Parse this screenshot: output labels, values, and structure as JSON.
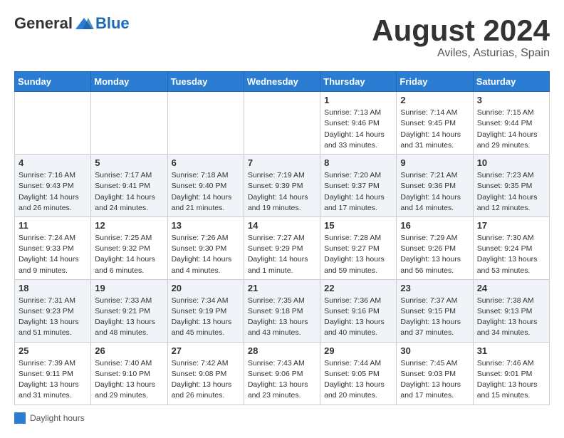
{
  "header": {
    "logo": {
      "general": "General",
      "blue": "Blue"
    },
    "title": "August 2024",
    "location": "Aviles, Asturias, Spain"
  },
  "calendar": {
    "days_of_week": [
      "Sunday",
      "Monday",
      "Tuesday",
      "Wednesday",
      "Thursday",
      "Friday",
      "Saturday"
    ],
    "weeks": [
      [
        {
          "day": "",
          "info": ""
        },
        {
          "day": "",
          "info": ""
        },
        {
          "day": "",
          "info": ""
        },
        {
          "day": "",
          "info": ""
        },
        {
          "day": "1",
          "info": "Sunrise: 7:13 AM\nSunset: 9:46 PM\nDaylight: 14 hours and 33 minutes."
        },
        {
          "day": "2",
          "info": "Sunrise: 7:14 AM\nSunset: 9:45 PM\nDaylight: 14 hours and 31 minutes."
        },
        {
          "day": "3",
          "info": "Sunrise: 7:15 AM\nSunset: 9:44 PM\nDaylight: 14 hours and 29 minutes."
        }
      ],
      [
        {
          "day": "4",
          "info": "Sunrise: 7:16 AM\nSunset: 9:43 PM\nDaylight: 14 hours and 26 minutes."
        },
        {
          "day": "5",
          "info": "Sunrise: 7:17 AM\nSunset: 9:41 PM\nDaylight: 14 hours and 24 minutes."
        },
        {
          "day": "6",
          "info": "Sunrise: 7:18 AM\nSunset: 9:40 PM\nDaylight: 14 hours and 21 minutes."
        },
        {
          "day": "7",
          "info": "Sunrise: 7:19 AM\nSunset: 9:39 PM\nDaylight: 14 hours and 19 minutes."
        },
        {
          "day": "8",
          "info": "Sunrise: 7:20 AM\nSunset: 9:37 PM\nDaylight: 14 hours and 17 minutes."
        },
        {
          "day": "9",
          "info": "Sunrise: 7:21 AM\nSunset: 9:36 PM\nDaylight: 14 hours and 14 minutes."
        },
        {
          "day": "10",
          "info": "Sunrise: 7:23 AM\nSunset: 9:35 PM\nDaylight: 14 hours and 12 minutes."
        }
      ],
      [
        {
          "day": "11",
          "info": "Sunrise: 7:24 AM\nSunset: 9:33 PM\nDaylight: 14 hours and 9 minutes."
        },
        {
          "day": "12",
          "info": "Sunrise: 7:25 AM\nSunset: 9:32 PM\nDaylight: 14 hours and 6 minutes."
        },
        {
          "day": "13",
          "info": "Sunrise: 7:26 AM\nSunset: 9:30 PM\nDaylight: 14 hours and 4 minutes."
        },
        {
          "day": "14",
          "info": "Sunrise: 7:27 AM\nSunset: 9:29 PM\nDaylight: 14 hours and 1 minute."
        },
        {
          "day": "15",
          "info": "Sunrise: 7:28 AM\nSunset: 9:27 PM\nDaylight: 13 hours and 59 minutes."
        },
        {
          "day": "16",
          "info": "Sunrise: 7:29 AM\nSunset: 9:26 PM\nDaylight: 13 hours and 56 minutes."
        },
        {
          "day": "17",
          "info": "Sunrise: 7:30 AM\nSunset: 9:24 PM\nDaylight: 13 hours and 53 minutes."
        }
      ],
      [
        {
          "day": "18",
          "info": "Sunrise: 7:31 AM\nSunset: 9:23 PM\nDaylight: 13 hours and 51 minutes."
        },
        {
          "day": "19",
          "info": "Sunrise: 7:33 AM\nSunset: 9:21 PM\nDaylight: 13 hours and 48 minutes."
        },
        {
          "day": "20",
          "info": "Sunrise: 7:34 AM\nSunset: 9:19 PM\nDaylight: 13 hours and 45 minutes."
        },
        {
          "day": "21",
          "info": "Sunrise: 7:35 AM\nSunset: 9:18 PM\nDaylight: 13 hours and 43 minutes."
        },
        {
          "day": "22",
          "info": "Sunrise: 7:36 AM\nSunset: 9:16 PM\nDaylight: 13 hours and 40 minutes."
        },
        {
          "day": "23",
          "info": "Sunrise: 7:37 AM\nSunset: 9:15 PM\nDaylight: 13 hours and 37 minutes."
        },
        {
          "day": "24",
          "info": "Sunrise: 7:38 AM\nSunset: 9:13 PM\nDaylight: 13 hours and 34 minutes."
        }
      ],
      [
        {
          "day": "25",
          "info": "Sunrise: 7:39 AM\nSunset: 9:11 PM\nDaylight: 13 hours and 31 minutes."
        },
        {
          "day": "26",
          "info": "Sunrise: 7:40 AM\nSunset: 9:10 PM\nDaylight: 13 hours and 29 minutes."
        },
        {
          "day": "27",
          "info": "Sunrise: 7:42 AM\nSunset: 9:08 PM\nDaylight: 13 hours and 26 minutes."
        },
        {
          "day": "28",
          "info": "Sunrise: 7:43 AM\nSunset: 9:06 PM\nDaylight: 13 hours and 23 minutes."
        },
        {
          "day": "29",
          "info": "Sunrise: 7:44 AM\nSunset: 9:05 PM\nDaylight: 13 hours and 20 minutes."
        },
        {
          "day": "30",
          "info": "Sunrise: 7:45 AM\nSunset: 9:03 PM\nDaylight: 13 hours and 17 minutes."
        },
        {
          "day": "31",
          "info": "Sunrise: 7:46 AM\nSunset: 9:01 PM\nDaylight: 13 hours and 15 minutes."
        }
      ]
    ]
  },
  "legend": {
    "text": "Daylight hours"
  }
}
